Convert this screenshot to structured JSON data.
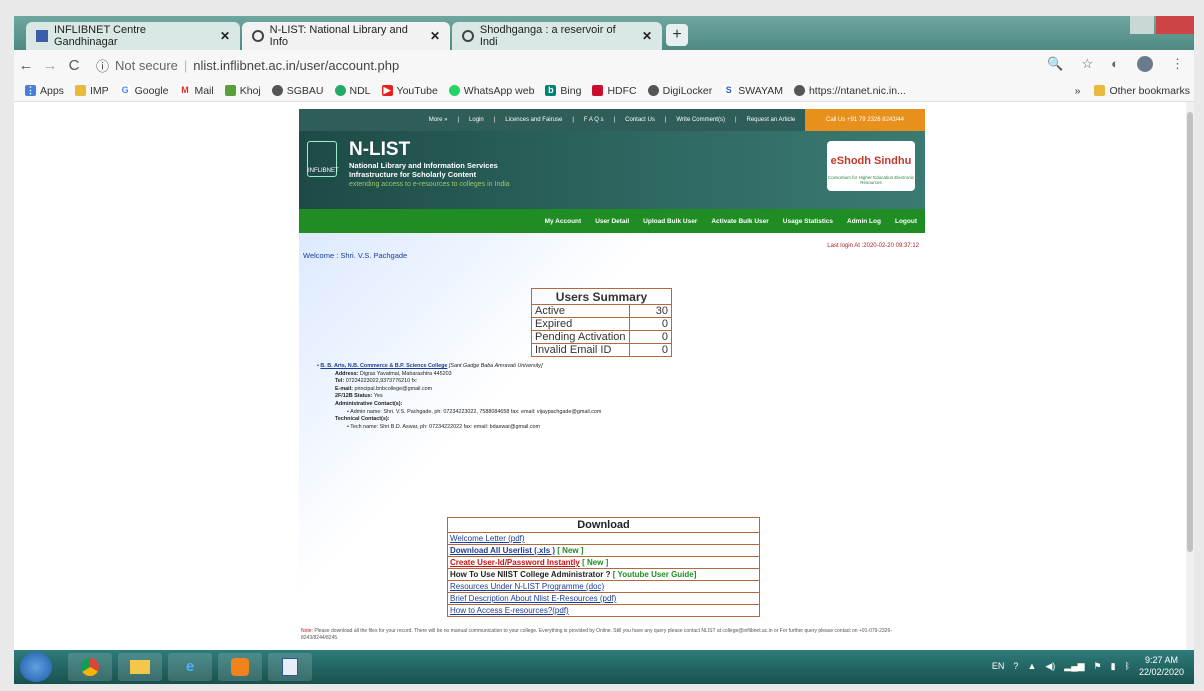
{
  "browser": {
    "tabs": [
      {
        "title": "INFLIBNET Centre Gandhinagar",
        "active": false
      },
      {
        "title": "N-LIST: National Library and Info",
        "active": true
      },
      {
        "title": "Shodhganga : a reservoir of Indi",
        "active": false
      }
    ],
    "new_tab": "+",
    "close": "✕",
    "security": "Not secure",
    "url": "nlist.inflibnet.ac.in/user/account.php",
    "bookmarks": [
      "Apps",
      "IMP",
      "Google",
      "Mail",
      "Khoj",
      "SGBAU",
      "NDL",
      "YouTube",
      "WhatsApp web",
      "Bing",
      "HDFC",
      "DigiLocker",
      "SWAYAM",
      "https://ntanet.nic.in..."
    ],
    "other_bookmarks": "Other bookmarks",
    "more": "»"
  },
  "site": {
    "topnav": [
      "More »",
      "Login",
      "Licences and Fairuse",
      "F A Q s",
      "Contact Us",
      "Write Comment(s)",
      "Request an Article"
    ],
    "call": "Call Us +91 79 2326 8243/44",
    "brand": "N-LIST",
    "brand_line1": "National Library and Information Services",
    "brand_line2": "Infrastructure for Scholarly Content",
    "brand_tag": "extending access to e-resources to colleges in India",
    "logo_text": "INFLIBNET",
    "eshodh_title": "eShodh Sindhu",
    "eshodh_sub": "Consortium for Higher Education Electronic Resources",
    "mainnav": [
      "My Account",
      "User Detail",
      "Upload Bulk User",
      "Activate Bulk User",
      "Usage Statistics",
      "Admin Log",
      "Logout"
    ],
    "welcome": "Welcome : Shri. V.S. Pachgade",
    "last_login": "Last login At :2020-02-20 09:37:12"
  },
  "summary": {
    "title": "Users Summary",
    "rows": [
      {
        "label": "Active",
        "value": "30"
      },
      {
        "label": "Expired",
        "value": "0"
      },
      {
        "label": "Pending Activation",
        "value": "0"
      },
      {
        "label": "Invalid Email ID",
        "value": "0"
      }
    ]
  },
  "college": {
    "name": "B. B. Arts, N.B. Commerce & B.P. Science College",
    "university": "[Sant Gadge Baba Amravati University]",
    "address_label": "Address:",
    "address": "Digras Yavatmal, Maharashtra 445203",
    "tel_label": "Tel:",
    "tel": "07234223022,9373776210 fx:",
    "email_label": "E-mail:",
    "email": "principal.bnbcollege@gmail.com",
    "status_label": "2F/12B Status:",
    "status": "Yes",
    "admin_label": "Administrative Contact(s):",
    "admin": "Admin name: Shri. V.S. Pachgade, ph: 07234223022, 7588084658 fax: email: vijaypachgade@gmail.com",
    "tech_label": "Technical Contact(s):",
    "tech": "Tech name: Shri B.D. Aswar, ph: 07234222022 fax: email: bdaswar@gmail.com"
  },
  "download": {
    "title": "Download",
    "welcome_letter": "Welcome Letter (pdf)",
    "all_userlist": "Download All Userlist (.xls )",
    "new_tag": "[ New ]",
    "create_user": "Create User-Id/Password Instantly",
    "how_to_use": "How To Use NlIST College Administrator ?",
    "youtube_guide": "[ Youtube User Guide]",
    "resources": "Resources Under N-LIST Programme (doc)",
    "brief": "Brief Description About Nlist E-Resources (pdf)",
    "access": "How to Access E-resources?(pdf)"
  },
  "note": {
    "label": "Note:",
    "text": "Please download all the files for your record. There will be no manual communication to your college. Everything is provided by Online. Still you have any query please contact NLIST at college@inflibnet.ac.in or For further query please contact on +91-079-2326-8243/8244/8245."
  },
  "taskbar": {
    "lang": "EN",
    "time": "9:27 AM",
    "date": "22/02/2020"
  }
}
